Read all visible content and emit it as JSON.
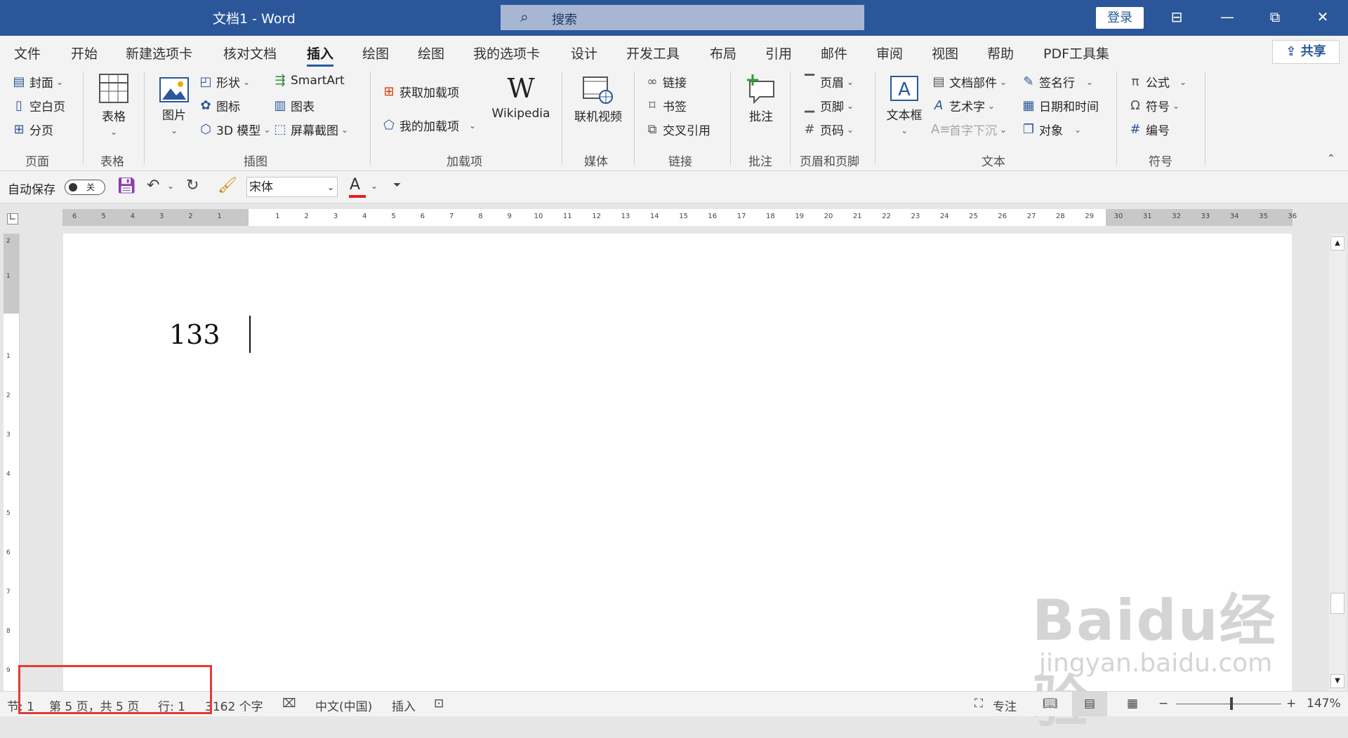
{
  "window": {
    "title": "文档1  -  Word",
    "search_placeholder": "搜索",
    "login_label": "登录",
    "buttons": {
      "ribbon_display": "⊟",
      "minimize": "—",
      "restore": "⧉",
      "close": "✕"
    }
  },
  "menu": {
    "tabs": [
      "文件",
      "开始",
      "新建选项卡",
      "核对文档",
      "插入",
      "绘图",
      "绘图",
      "我的选项卡",
      "设计",
      "开发工具",
      "布局",
      "引用",
      "邮件",
      "审阅",
      "视图",
      "帮助",
      "PDF工具集"
    ],
    "active_tab": "插入",
    "share_label": "共享"
  },
  "ribbon": {
    "pages": {
      "label": "页面",
      "items": [
        "封面",
        "空白页",
        "分页"
      ]
    },
    "tables": {
      "label": "表格",
      "table_label": "表格"
    },
    "illustrations": {
      "label": "插图",
      "picture_label": "图片",
      "items": [
        "形状",
        "图标",
        "3D 模型",
        "SmartArt",
        "图表",
        "屏幕截图"
      ]
    },
    "addins": {
      "label": "加载项",
      "get_addins": "获取加载项",
      "my_addins": "我的加载项",
      "wikipedia": "Wikipedia"
    },
    "media": {
      "label": "媒体",
      "online_video": "联机视频"
    },
    "links": {
      "label": "链接",
      "items": [
        "链接",
        "书签",
        "交叉引用"
      ]
    },
    "comments": {
      "label": "批注",
      "comment": "批注"
    },
    "header_footer": {
      "label": "页眉和页脚",
      "items": [
        "页眉",
        "页脚",
        "页码"
      ]
    },
    "text": {
      "label": "文本",
      "textbox": "文本框",
      "items": [
        "文档部件",
        "艺术字",
        "首字下沉",
        "签名行",
        "日期和时间",
        "对象"
      ]
    },
    "symbols": {
      "label": "符号",
      "items": [
        "公式",
        "符号",
        "编号"
      ]
    }
  },
  "qat": {
    "autosave_label": "自动保存",
    "autosave_state": "关",
    "font_name": "宋体",
    "font_color": "#e51c23"
  },
  "ruler": {
    "left_numbers": [
      "6",
      "5",
      "4",
      "3",
      "2",
      "1"
    ],
    "right_numbers": [
      "1",
      "2",
      "3",
      "4",
      "5",
      "6",
      "7",
      "8",
      "9",
      "10",
      "11",
      "12",
      "13",
      "14",
      "15",
      "16",
      "17",
      "18",
      "19",
      "20",
      "21",
      "22",
      "23",
      "24",
      "25",
      "26",
      "27",
      "28",
      "29",
      "30",
      "31",
      "32",
      "33",
      "34",
      "35",
      "36"
    ],
    "vertical_numbers": [
      "2",
      "1",
      "1",
      "2",
      "3",
      "4",
      "5",
      "6",
      "7",
      "8",
      "9"
    ]
  },
  "document": {
    "body_text": "133"
  },
  "watermark": {
    "logo_text": "Baidu经验",
    "url_text": "jingyan.baidu.com"
  },
  "status": {
    "section": "节: 1",
    "page": "第 5 页，共 5 页",
    "line": "行: 1",
    "words": "3162 个字",
    "language": "中文(中国)",
    "mode": "插入",
    "focus": "专注",
    "zoom_minus": "−",
    "zoom_plus": "+",
    "zoom": "147%"
  },
  "colors": {
    "title_bar": "#2b579a",
    "highlight_box": "#e53935"
  }
}
